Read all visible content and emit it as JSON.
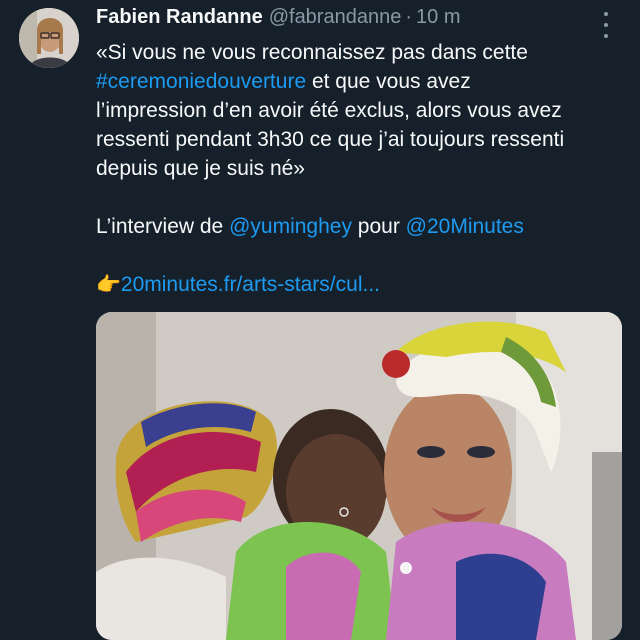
{
  "tweet": {
    "author_name": "Fabien Randanne",
    "author_handle": "@fabrandanne",
    "separator": "·",
    "timestamp": "10 m",
    "lines": {
      "l1": "«Si vous ne vous reconnaissez pas dans cette",
      "hashtag": "#ceremoniedouverture",
      "l2_rest": " et que vous avez",
      "l3": "l’impression d’en avoir été exclus, alors vous avez",
      "l4": "ressenti pendant 3h30 ce que j’ai toujours ressenti",
      "l5": "depuis que je suis né»",
      "interview_prefix": "L’interview de ",
      "mention1": "@yuminghey",
      "interview_mid": " pour ",
      "mention2": "@20Minutes",
      "pointer_emoji": "👉",
      "link": "20minutes.fr/arts-stars/cul..."
    }
  },
  "icons": {
    "more": "more-options-icon"
  }
}
